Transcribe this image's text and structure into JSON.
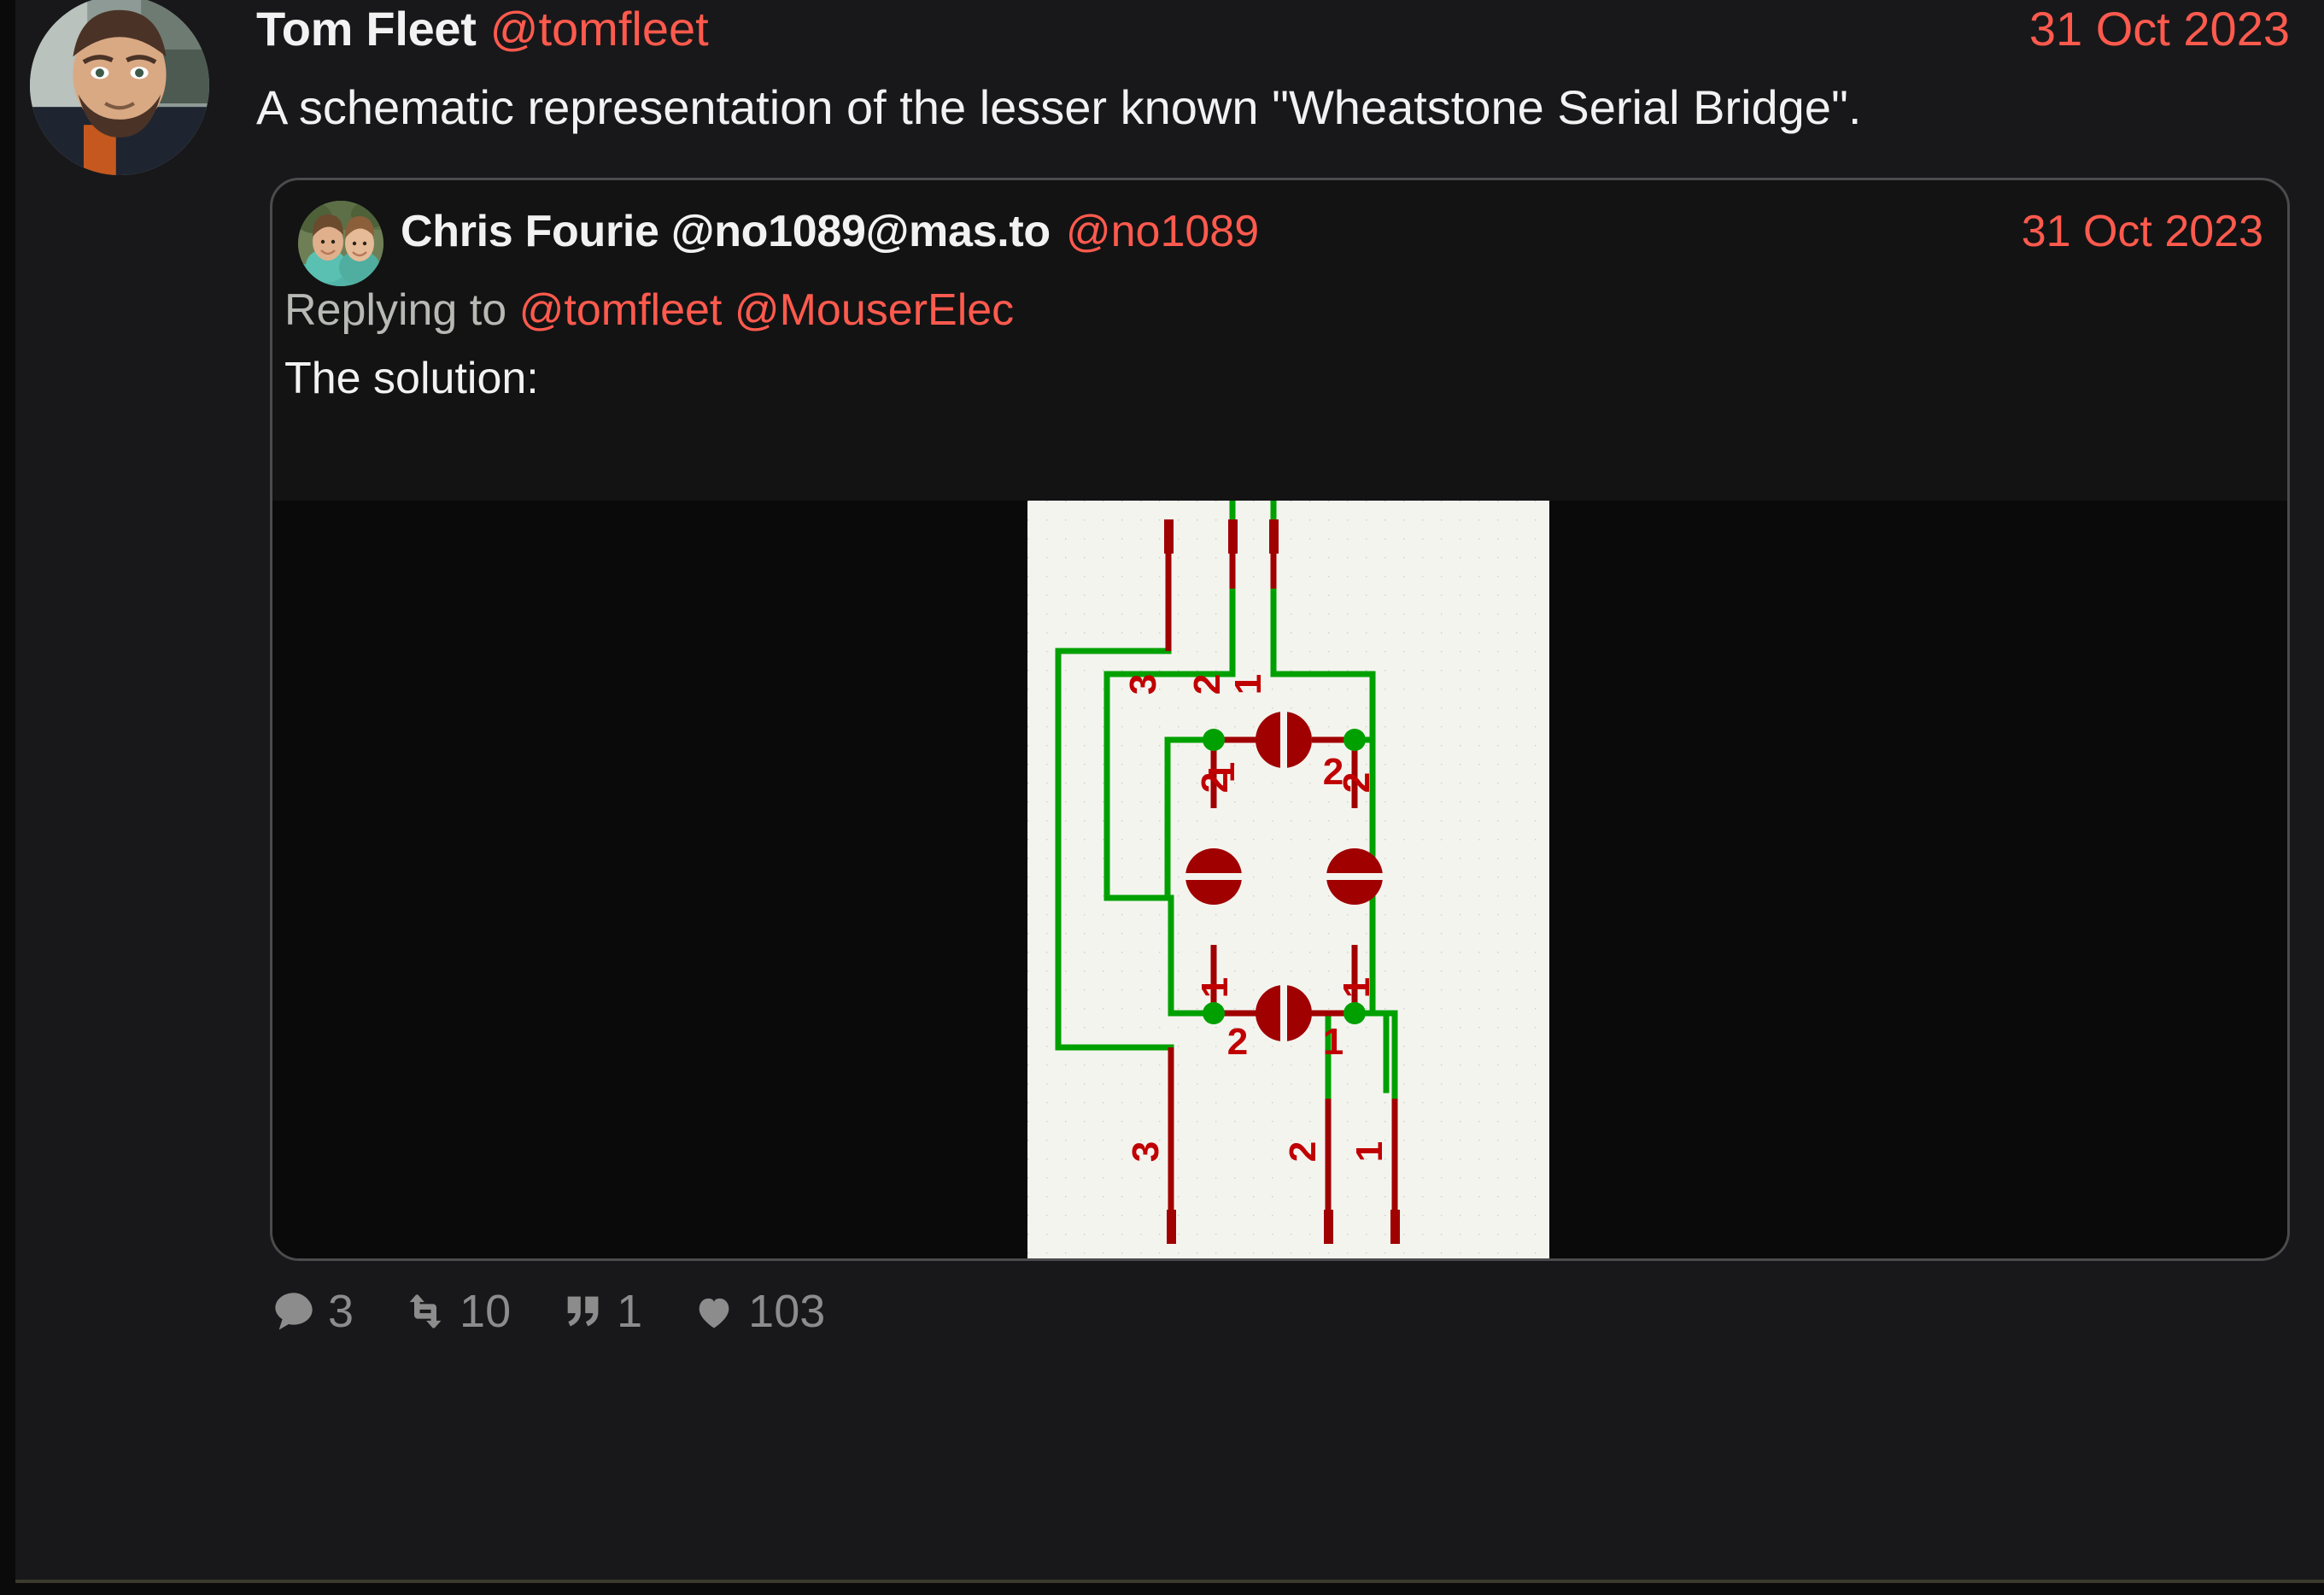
{
  "status": {
    "author": {
      "display_name": "Tom Fleet",
      "handle": "@tomfleet",
      "avatar_icon": "avatar-photo-tom-fleet"
    },
    "date": "31 Oct 2023",
    "body": "A schematic representation of the lesser known \"Wheatstone Serial Bridge\"."
  },
  "quote": {
    "author": {
      "display_name": "Chris Fourie @no1089@mas.to",
      "handle": "@no1089",
      "avatar_icon": "avatar-photo-chris-fourie"
    },
    "date": "31 Oct 2023",
    "replying_to_label": "Replying to",
    "replying_to_mentions": [
      "@tomfleet",
      "@MouserElec"
    ],
    "body": "The solution:",
    "media": {
      "alt": "KiCad schematic of a Wheatstone bridge built from four resistors with green wiring and red pin stubs",
      "background_color": "#f4f4ef",
      "wire_color": "#00a000",
      "component_color": "#a00000",
      "junction_color": "#00a000",
      "top_pin_labels": [
        "3",
        "2",
        "1"
      ],
      "bottom_pin_labels": [
        "3",
        "2",
        "1"
      ],
      "resistor_pin_labels": {
        "top_resistor": [
          "1",
          "2"
        ],
        "left_resistor": [
          "2",
          "1"
        ],
        "right_resistor": [
          "2",
          "1"
        ],
        "bottom_resistor": [
          "2",
          "1"
        ]
      }
    }
  },
  "stats": [
    {
      "name": "replies",
      "icon": "comment-icon",
      "count": "3"
    },
    {
      "name": "reposts",
      "icon": "repeat-icon",
      "count": "10"
    },
    {
      "name": "quotes",
      "icon": "quote-icon",
      "count": "1"
    },
    {
      "name": "likes",
      "icon": "heart-icon",
      "count": "103"
    }
  ],
  "colors": {
    "background": "#18181a",
    "card_background": "#131314",
    "accent": "#ff5a4d",
    "text": "#f2f2f2",
    "muted": "#8c8c8c",
    "border": "#4b4b4d"
  }
}
